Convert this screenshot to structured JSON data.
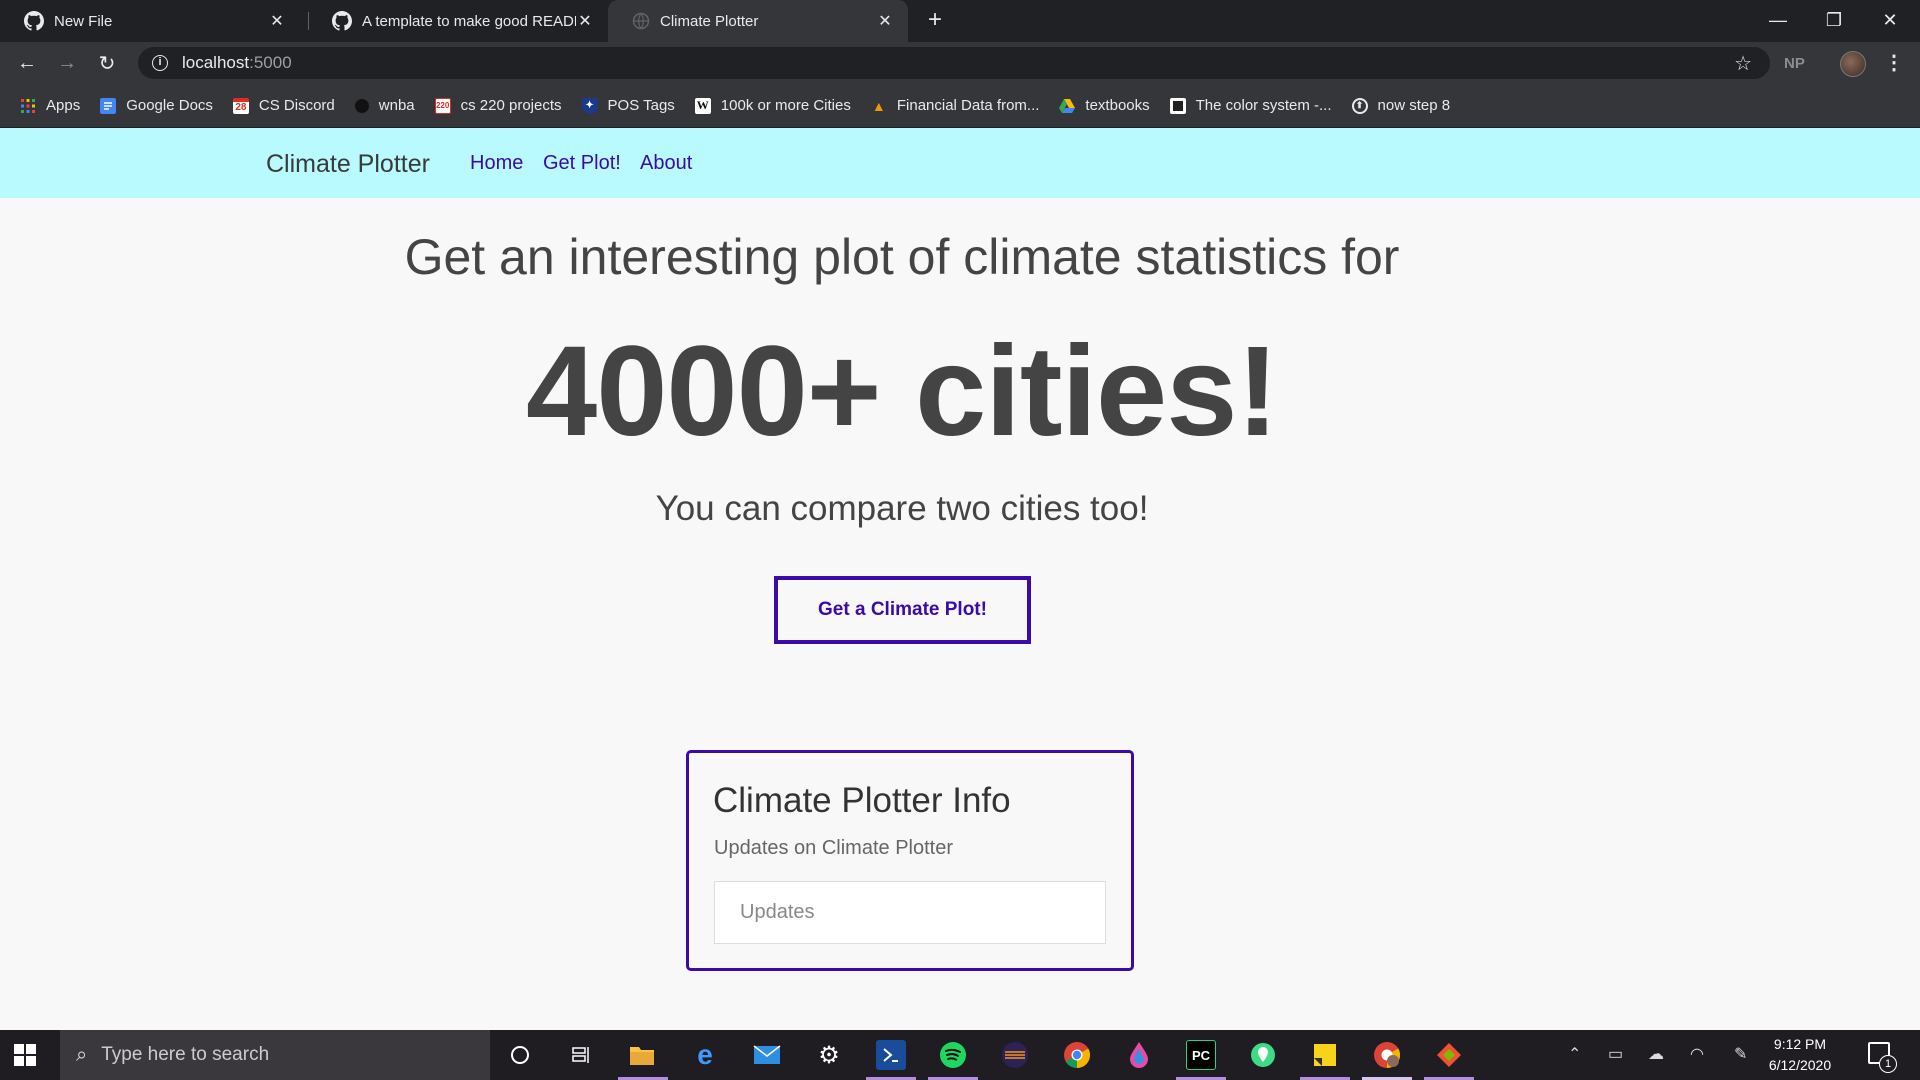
{
  "browser": {
    "tabs": [
      {
        "title": "New File",
        "icon": "github-icon",
        "active": false
      },
      {
        "title": "A template to make good README",
        "icon": "github-icon",
        "active": false
      },
      {
        "title": "Climate Plotter",
        "icon": "globe-icon",
        "active": true
      }
    ],
    "url_host": "localhost",
    "url_port": ":5000",
    "profile_initials": "NP",
    "bookmarks": [
      {
        "label": "Apps",
        "icon": "apps-grid-icon"
      },
      {
        "label": "Google Docs",
        "icon": "google-docs-icon"
      },
      {
        "label": "CS Discord",
        "icon": "calendar-icon"
      },
      {
        "label": "wnba",
        "icon": "circle-icon"
      },
      {
        "label": "cs 220 projects",
        "icon": "cs220-icon"
      },
      {
        "label": "POS Tags",
        "icon": "upenn-icon"
      },
      {
        "label": "100k or more Cities",
        "icon": "wikipedia-icon"
      },
      {
        "label": "Financial Data from...",
        "icon": "flame-icon"
      },
      {
        "label": "textbooks",
        "icon": "google-drive-icon"
      },
      {
        "label": "The color system -...",
        "icon": "material-icon"
      },
      {
        "label": "now step 8",
        "icon": "step-icon"
      }
    ]
  },
  "navbar": {
    "brand": "Climate Plotter",
    "links": [
      "Home",
      "Get Plot!",
      "About"
    ]
  },
  "hero": {
    "headline": "Get an interesting plot of climate statistics for",
    "big": "4000+ cities!",
    "sub": "You can compare two cities too!",
    "cta_label": "Get a Climate Plot!"
  },
  "info_card": {
    "title": "Climate Plotter Info",
    "subtitle": "Updates on Climate Plotter",
    "input_placeholder": "Updates"
  },
  "taskbar": {
    "search_placeholder": "Type here to search",
    "time": "9:12 PM",
    "date": "6/12/2020",
    "notification_count": "1"
  },
  "colors": {
    "navbar_bg": "#b8fafd",
    "accent": "#3b0aa8",
    "text": "#444444"
  }
}
